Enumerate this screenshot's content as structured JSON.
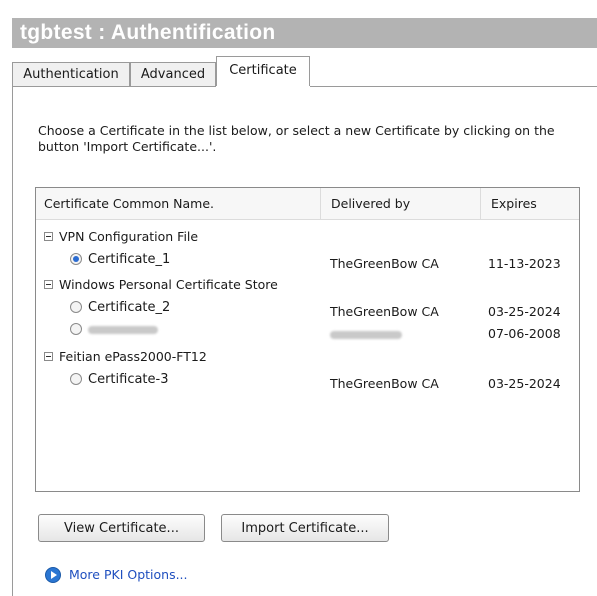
{
  "window": {
    "title": "tgbtest : Authentification"
  },
  "tabs": [
    {
      "label": "Authentication",
      "active": false
    },
    {
      "label": "Advanced",
      "active": false
    },
    {
      "label": "Certificate",
      "active": true
    }
  ],
  "description": "Choose a Certificate in the list below, or select a new Certificate by clicking on the button 'Import Certificate...'.",
  "list": {
    "columns": [
      "Certificate Common Name.",
      "Delivered by",
      "Expires"
    ],
    "groups": [
      {
        "name": "VPN Configuration File",
        "items": [
          {
            "name": "Certificate_1",
            "delivered_by": "TheGreenBow CA",
            "expires": "11-13-2023",
            "selected": true
          }
        ]
      },
      {
        "name": "Windows Personal Certificate Store",
        "items": [
          {
            "name": "Certificate_2",
            "delivered_by": "TheGreenBow CA",
            "expires": "03-25-2024",
            "selected": false
          },
          {
            "name": "",
            "delivered_by": "",
            "expires": "07-06-2008",
            "selected": false,
            "redacted": true
          }
        ]
      },
      {
        "name": "Feitian ePass2000-FT12",
        "items": [
          {
            "name": "Certificate-3",
            "delivered_by": "TheGreenBow CA",
            "expires": "03-25-2024",
            "selected": false
          }
        ]
      }
    ]
  },
  "buttons": {
    "view": "View Certificate...",
    "import": "Import Certificate..."
  },
  "link": {
    "label": "More PKI Options...",
    "icon": "play-circle-icon",
    "color": "#1f4fbf"
  },
  "colors": {
    "titlebar": "#b3b3b3",
    "selected_radio": "#2a6bd1"
  }
}
